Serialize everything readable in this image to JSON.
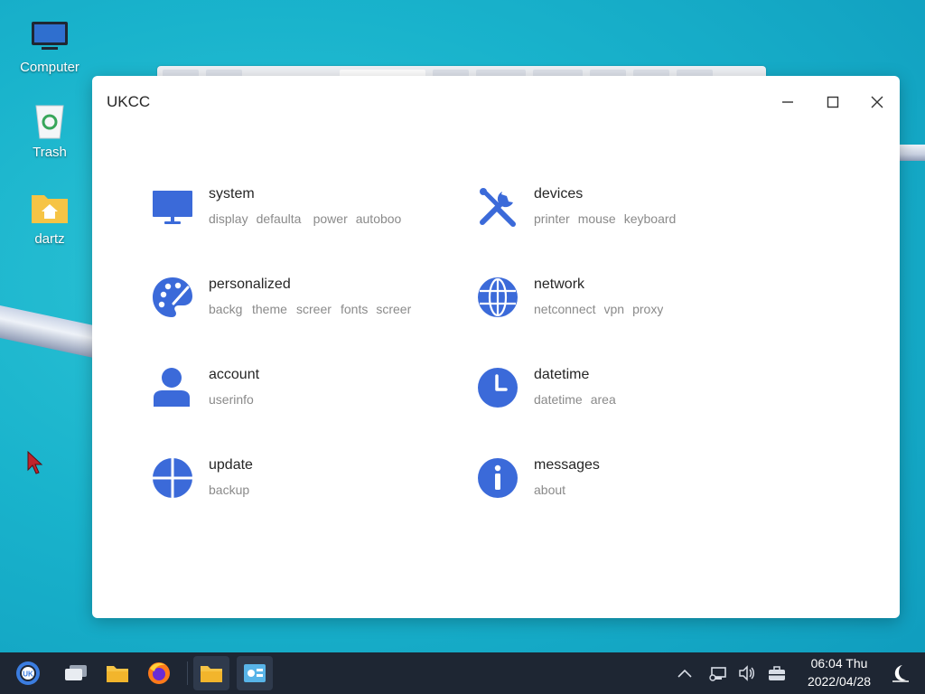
{
  "desktop": {
    "icons": [
      {
        "label": "Computer"
      },
      {
        "label": "Trash"
      },
      {
        "label": "dartz"
      }
    ]
  },
  "window": {
    "title": "UKCC",
    "controls": {
      "minimize": "minimize",
      "maximize": "maximize",
      "close": "close"
    }
  },
  "categories": [
    {
      "name": "system",
      "icon": "monitor-icon",
      "subs": [
        "display",
        "defaulta",
        "power",
        "autoboo"
      ]
    },
    {
      "name": "devices",
      "icon": "tools-icon",
      "subs": [
        "printer",
        "mouse",
        "keyboard"
      ]
    },
    {
      "name": "personalized",
      "icon": "palette-icon",
      "subs": [
        "backg",
        "theme",
        "screer",
        "fonts",
        "screer"
      ]
    },
    {
      "name": "network",
      "icon": "globe-icon",
      "subs": [
        "netconnect",
        "vpn",
        "proxy"
      ]
    },
    {
      "name": "account",
      "icon": "user-icon",
      "subs": [
        "userinfo"
      ]
    },
    {
      "name": "datetime",
      "icon": "clock-icon",
      "subs": [
        "datetime",
        "area"
      ]
    },
    {
      "name": "update",
      "icon": "update-icon",
      "subs": [
        "backup"
      ]
    },
    {
      "name": "messages",
      "icon": "info-icon",
      "subs": [
        "about"
      ]
    }
  ],
  "taskbar": {
    "time": "06:04 Thu",
    "date": "2022/04/28"
  },
  "colors": {
    "accent": "#3b6ad9",
    "taskbar": "#1e2633"
  }
}
